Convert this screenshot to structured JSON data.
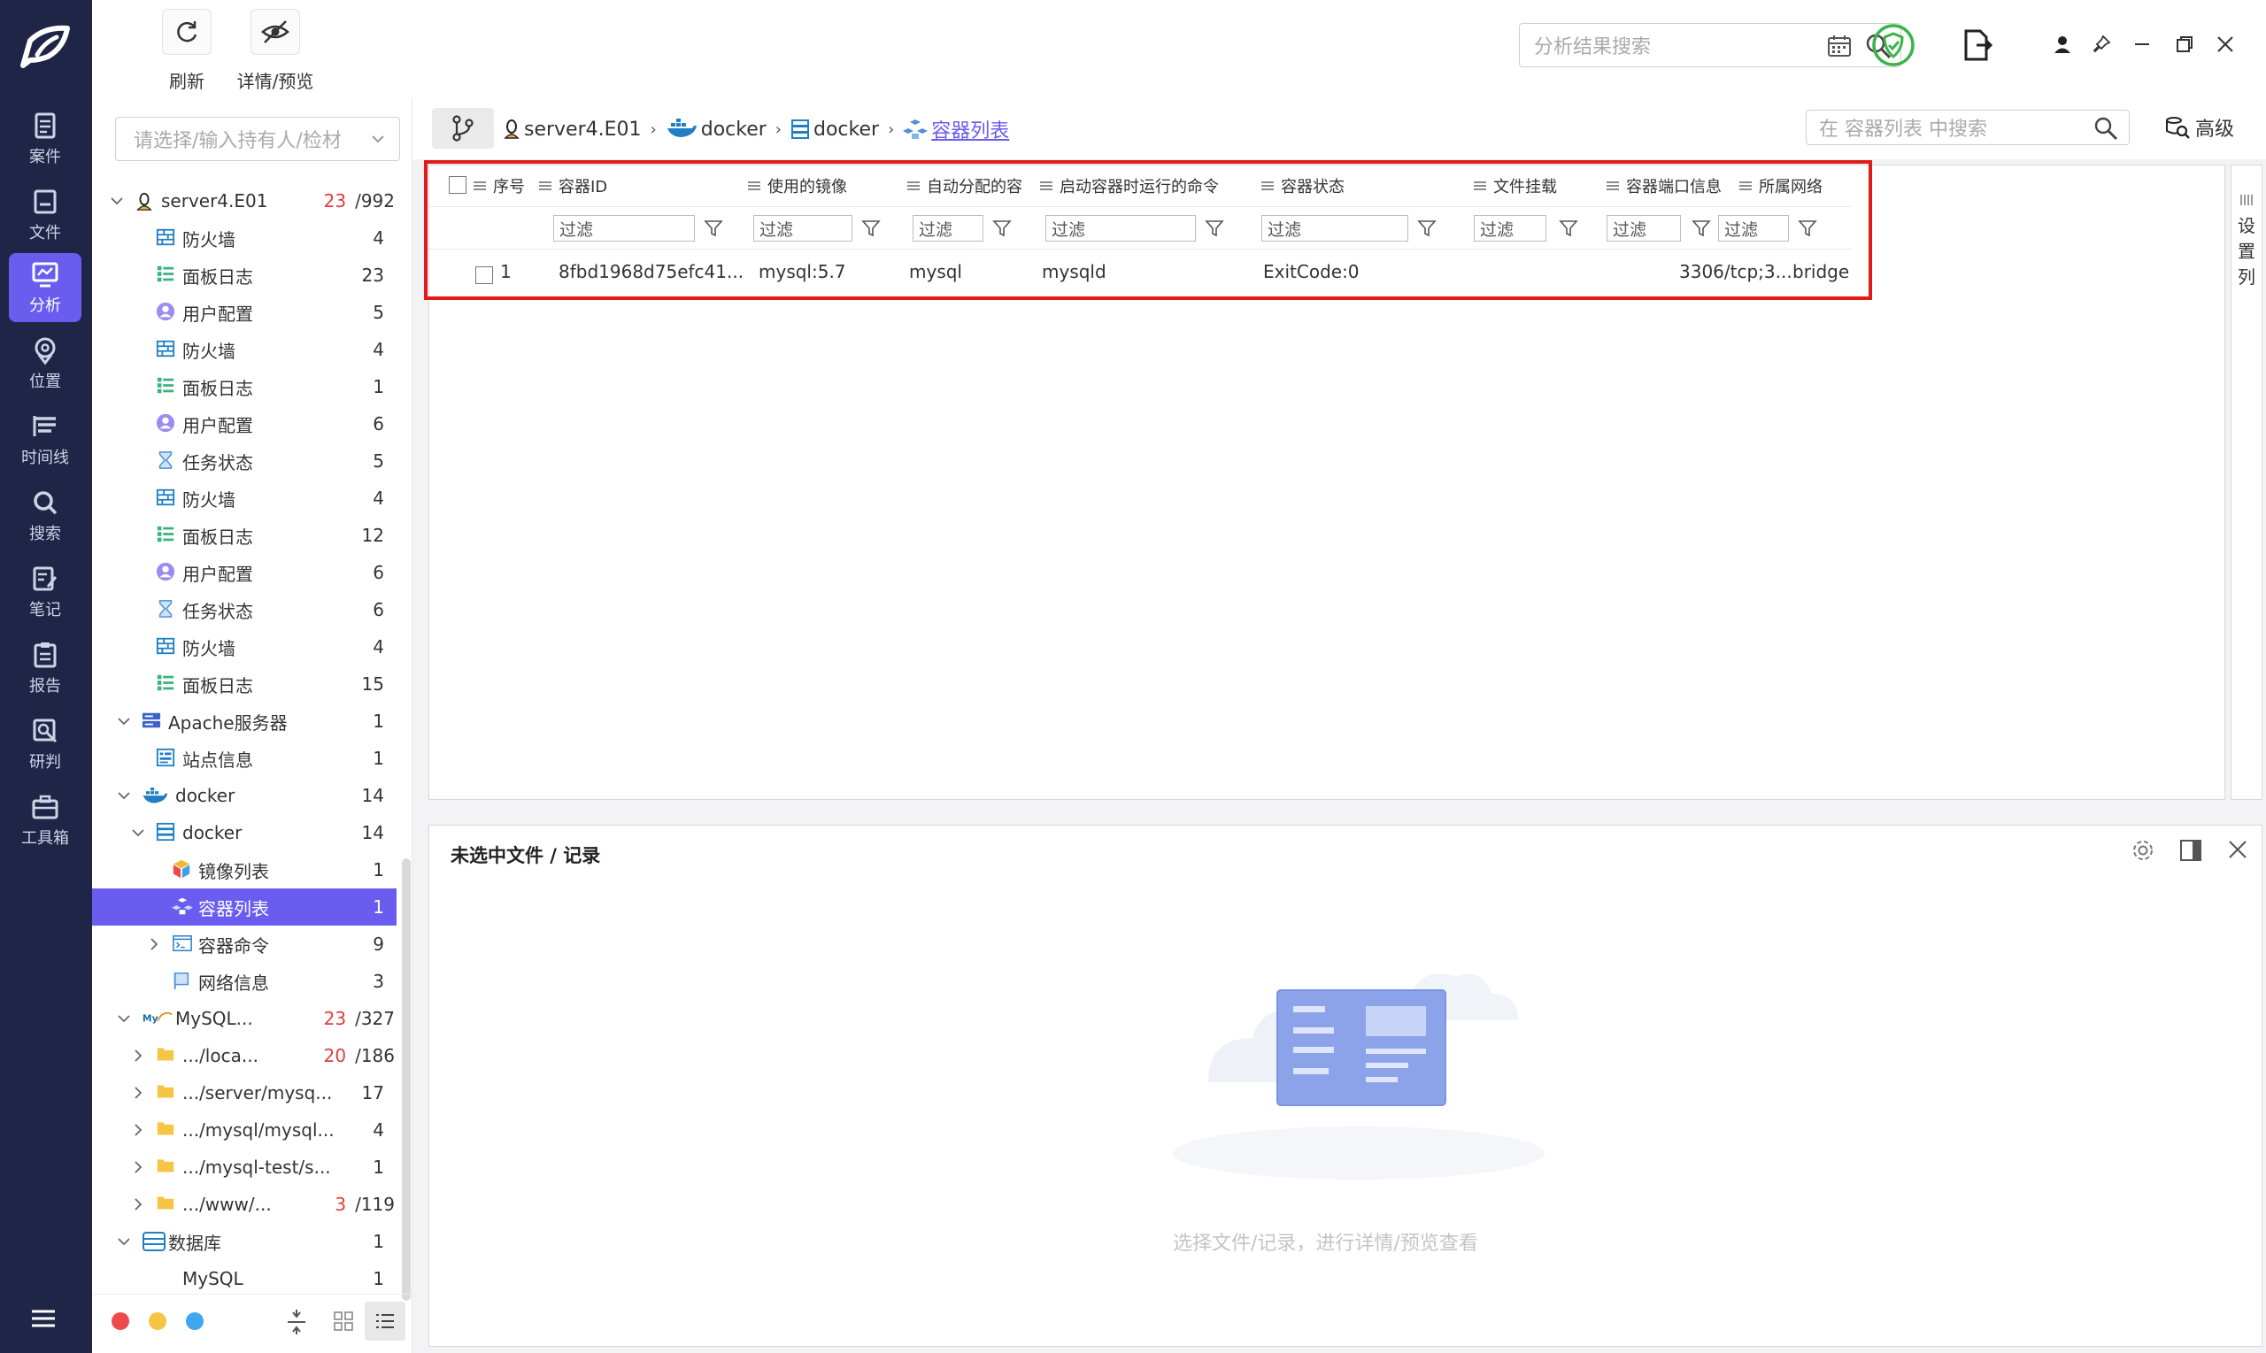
{
  "nav": {
    "items": [
      {
        "label": "案件",
        "icon": "case-icon"
      },
      {
        "label": "文件",
        "icon": "file-icon"
      },
      {
        "label": "分析",
        "icon": "analysis-icon",
        "active": true
      },
      {
        "label": "位置",
        "icon": "location-icon"
      },
      {
        "label": "时间线",
        "icon": "timeline-icon"
      },
      {
        "label": "搜索",
        "icon": "search-icon"
      },
      {
        "label": "笔记",
        "icon": "note-icon"
      },
      {
        "label": "报告",
        "icon": "report-icon"
      },
      {
        "label": "研判",
        "icon": "judge-icon"
      },
      {
        "label": "工具箱",
        "icon": "toolbox-icon"
      }
    ]
  },
  "toolbar": {
    "refresh_label": "刷新",
    "detail_preview_label": "详情/预览",
    "search_placeholder": "分析结果搜索"
  },
  "tree": {
    "holder_placeholder": "请选择/输入持有人/检材",
    "rows": [
      {
        "label": "server4.E01",
        "count_red": "23",
        "count": "/992",
        "icon": "linux-icon",
        "level": 0,
        "expanded": true
      },
      {
        "label": "防火墙",
        "count": "4",
        "icon": "firewall-icon",
        "level": 1
      },
      {
        "label": "面板日志",
        "count": "23",
        "icon": "panel-log-icon",
        "level": 1
      },
      {
        "label": "用户配置",
        "count": "5",
        "icon": "user-config-icon",
        "level": 1
      },
      {
        "label": "防火墙",
        "count": "4",
        "icon": "firewall-icon",
        "level": 1
      },
      {
        "label": "面板日志",
        "count": "1",
        "icon": "panel-log-icon",
        "level": 1
      },
      {
        "label": "用户配置",
        "count": "6",
        "icon": "user-config-icon",
        "level": 1
      },
      {
        "label": "任务状态",
        "count": "5",
        "icon": "task-status-icon",
        "level": 1
      },
      {
        "label": "防火墙",
        "count": "4",
        "icon": "firewall-icon",
        "level": 1
      },
      {
        "label": "面板日志",
        "count": "12",
        "icon": "panel-log-icon",
        "level": 1
      },
      {
        "label": "用户配置",
        "count": "6",
        "icon": "user-config-icon",
        "level": 1
      },
      {
        "label": "任务状态",
        "count": "6",
        "icon": "task-status-icon",
        "level": 1
      },
      {
        "label": "防火墙",
        "count": "4",
        "icon": "firewall-icon",
        "level": 1
      },
      {
        "label": "面板日志",
        "count": "15",
        "icon": "panel-log-icon",
        "level": 1
      },
      {
        "label": "Apache服务器",
        "count": "1",
        "icon": "server-icon",
        "level": 0.5,
        "expanded": true
      },
      {
        "label": "站点信息",
        "count": "1",
        "icon": "site-info-icon",
        "level": 1
      },
      {
        "label": "docker",
        "count": "14",
        "icon": "docker-icon",
        "level": 0.5,
        "expanded": true
      },
      {
        "label": "docker",
        "count": "14",
        "icon": "docker-db-icon",
        "level": 1,
        "expanded": true
      },
      {
        "label": "镜像列表",
        "count": "1",
        "icon": "image-list-icon",
        "level": 2
      },
      {
        "label": "容器列表",
        "count": "1",
        "icon": "container-list-icon",
        "level": 2,
        "selected": true
      },
      {
        "label": "容器命令",
        "count": "9",
        "icon": "container-cmd-icon",
        "level": 2,
        "collapsed": true
      },
      {
        "label": "网络信息",
        "count": "3",
        "icon": "network-info-icon",
        "level": 2
      },
      {
        "label": "MySQL...",
        "count_red": "23",
        "count": "/327",
        "icon": "mysql-icon",
        "level": 0.5,
        "expanded": true
      },
      {
        "label": ".../loca...",
        "count_red": "20",
        "count": "/186",
        "icon": "folder-icon",
        "level": 1,
        "collapsed": true
      },
      {
        "label": ".../server/mysq...",
        "count": "17",
        "icon": "folder-icon",
        "level": 1,
        "collapsed": true
      },
      {
        "label": ".../mysql/mysql...",
        "count": "4",
        "icon": "folder-icon",
        "level": 1,
        "collapsed": true
      },
      {
        "label": ".../mysql-test/s...",
        "count": "1",
        "icon": "folder-icon",
        "level": 1,
        "collapsed": true
      },
      {
        "label": ".../www/...",
        "count_red": "3",
        "count": "/119",
        "icon": "folder-icon",
        "level": 1,
        "collapsed": true
      },
      {
        "label": "数据库",
        "count": "1",
        "icon": "database-icon",
        "level": 0.5,
        "expanded": true
      },
      {
        "label": "MySQL",
        "count": "1",
        "icon": "",
        "level": 1
      }
    ]
  },
  "breadcrumb": {
    "items": [
      "server4.E01",
      "docker",
      "docker",
      "容器列表"
    ],
    "search_placeholder": "在 容器列表 中搜索",
    "advanced_label": "高级"
  },
  "grid": {
    "columns": [
      "序号",
      "容器ID",
      "使用的镜像",
      "自动分配的容",
      "启动容器时运行的命令",
      "容器状态",
      "文件挂载",
      "容器端口信息",
      "所属网络"
    ],
    "filter_placeholder": "过滤",
    "rows": [
      [
        "1",
        "8fbd1968d75efc41...",
        "mysql:5.7",
        "mysql",
        "mysqld",
        "ExitCode:0",
        "",
        "3306/tcp;3...",
        "bridge"
      ]
    ],
    "side_label": [
      "设",
      "置",
      "列"
    ]
  },
  "detail": {
    "title": "未选中文件 / 记录",
    "empty_text": "选择文件/记录，进行详情/预览查看"
  },
  "colors": {
    "rail_bg": "#1f2547",
    "accent": "#6b5cf0",
    "highlight_box": "#e31a1a"
  }
}
